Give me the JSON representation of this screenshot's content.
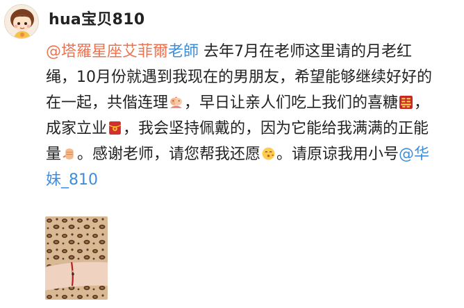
{
  "post": {
    "username": "hua宝贝810",
    "content": {
      "mention_prefix": "@塔羅星座艾菲爾",
      "mention_suffix": "老師",
      "line1_text": " 去年7月在老师这里请的月老红",
      "line2_text": "绳，10月份就遇到我现在的男朋友，希望能够继续好好的",
      "line3_a": "在一起，共偕连理",
      "line3_b": "，早日让亲人们吃上我们的喜糖",
      "line3_c": "，",
      "line4_a": "成家立业",
      "line4_b": "，我会坚持佩戴的，因为它能给我满满的正能",
      "line5_a": "量",
      "line5_b": "。感谢老师，请您帮我还愿",
      "line5_c": "。请原谅我用小号",
      "line5_link": "@华",
      "line6_link": "妹_810"
    },
    "emojis": {
      "couple": "couple-icon",
      "double_happiness": "double-happiness-icon",
      "red_envelope": "red-envelope-icon",
      "fist": "fist-icon",
      "kiss": "kiss-face-icon"
    },
    "colors": {
      "mention_orange": "#eb7350",
      "link_blue": "#3d8ddb",
      "text": "#222222"
    }
  }
}
